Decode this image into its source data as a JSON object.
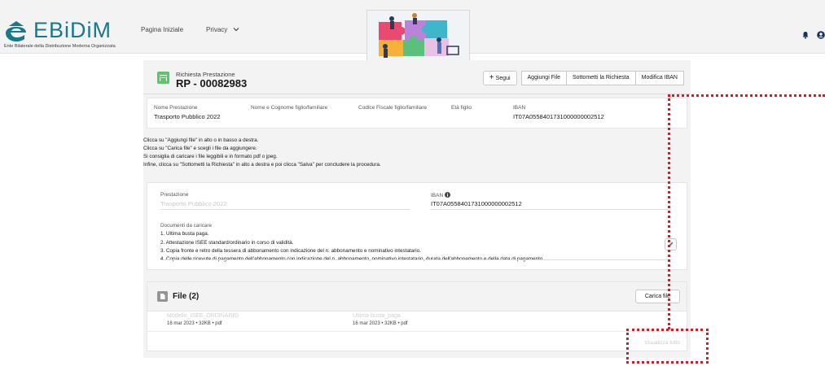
{
  "brand": {
    "name": "EBiDiM",
    "subtitle": "Ente Bilaterale della Distribuzione Moderna Organizzata",
    "accent": "#167a8c"
  },
  "nav": {
    "items": [
      {
        "label": "Pagina Iniziale"
      },
      {
        "label": "Privacy",
        "has_dropdown": true
      }
    ]
  },
  "record": {
    "type": "Richiesta Prestazione",
    "id": "RP - 00082983"
  },
  "actions": {
    "follow": "Segui",
    "add_file": "Aggiungi File",
    "submit": "Sottometti la Richiesta",
    "edit_iban": "Modifica IBAN"
  },
  "fields": [
    {
      "label": "Nome Prestazione",
      "value": "Trasporto Pubblico 2022"
    },
    {
      "label": "Nome e Cognome figlio/familiare",
      "value": ""
    },
    {
      "label": "Codice Fiscale figlio/familiare",
      "value": ""
    },
    {
      "label": "Età figlio",
      "value": ""
    },
    {
      "label": "IBAN",
      "value": "IT07A0558401731000000002512"
    }
  ],
  "instructions": [
    "Clicca su \"Aggiungi file\" in alto o in basso a destra.",
    "Clicca su \"Carica file\" e scegli i file da aggiungere.",
    "Si consiglia di caricare i file leggibili e in formato pdf o jpeg.",
    "Infine, clicca su \"Sottometti la Richiesta\" in alto a destra  e poi clicca \"Salva\" per concludere la procedura."
  ],
  "detail": {
    "prestazione_label": "Prestazione",
    "prestazione_value": "Trasporto Pubblico 2022",
    "iban_label": "IBAN",
    "iban_value": "IT07A0558401731000000002512",
    "docs_label": "Documenti da caricare",
    "docs": [
      "1. Ultima busta paga.",
      "2. Attestazione ISEE standard/ordinario in corso di validità.",
      "3. Copia fronte e retro della tessera di abbonamento con indicazione del n. abbonamento e nominativo intestatario.",
      "4. Copia delle ricevute di pagamento dell'abbonamento con indicazione del n. abbonamento, nominativo intestatario, durata dell'abbonamento e della data di pagamento."
    ]
  },
  "files": {
    "title": "File (2)",
    "upload_label": "Carica file",
    "items": [
      {
        "name": "Modello_ISEE_ORDINARIO",
        "meta": "16 mar 2023  •  32KB  •  pdf"
      },
      {
        "name": "Ultima-busta_paga",
        "meta": "16 mar 2023  •  32KB  •  pdf"
      }
    ],
    "view_all": "Visualizza tutto"
  },
  "colors": {
    "record_icon": "#5fc36c",
    "highlight": "#c0262d"
  }
}
